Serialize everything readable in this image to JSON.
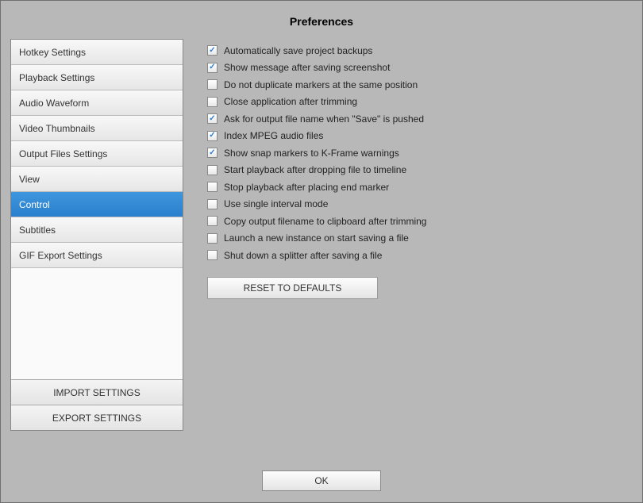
{
  "title": "Preferences",
  "sidebar": {
    "tabs": [
      {
        "label": "Hotkey Settings",
        "selected": false
      },
      {
        "label": "Playback Settings",
        "selected": false
      },
      {
        "label": "Audio Waveform",
        "selected": false
      },
      {
        "label": "Video Thumbnails",
        "selected": false
      },
      {
        "label": "Output Files Settings",
        "selected": false
      },
      {
        "label": "View",
        "selected": false
      },
      {
        "label": "Control",
        "selected": true
      },
      {
        "label": "Subtitles",
        "selected": false
      },
      {
        "label": "GIF Export Settings",
        "selected": false
      }
    ],
    "import_label": "IMPORT SETTINGS",
    "export_label": "EXPORT SETTINGS"
  },
  "checkboxes": [
    {
      "label": "Automatically save project backups",
      "checked": true
    },
    {
      "label": "Show message after saving screenshot",
      "checked": true
    },
    {
      "label": "Do not duplicate markers at the same position",
      "checked": false
    },
    {
      "label": "Close application after trimming",
      "checked": false
    },
    {
      "label": "Ask for output file name when \"Save\" is pushed",
      "checked": true
    },
    {
      "label": "Index MPEG audio files",
      "checked": true
    },
    {
      "label": "Show snap markers to K-Frame warnings",
      "checked": true
    },
    {
      "label": "Start playback after dropping file to timeline",
      "checked": false
    },
    {
      "label": "Stop playback after placing end marker",
      "checked": false
    },
    {
      "label": "Use single interval mode",
      "checked": false
    },
    {
      "label": "Copy output filename to clipboard after trimming",
      "checked": false
    },
    {
      "label": "Launch a new instance on start saving a file",
      "checked": false
    },
    {
      "label": "Shut down a splitter after saving a file",
      "checked": false
    }
  ],
  "reset_label": "RESET TO DEFAULTS",
  "ok_label": "OK"
}
